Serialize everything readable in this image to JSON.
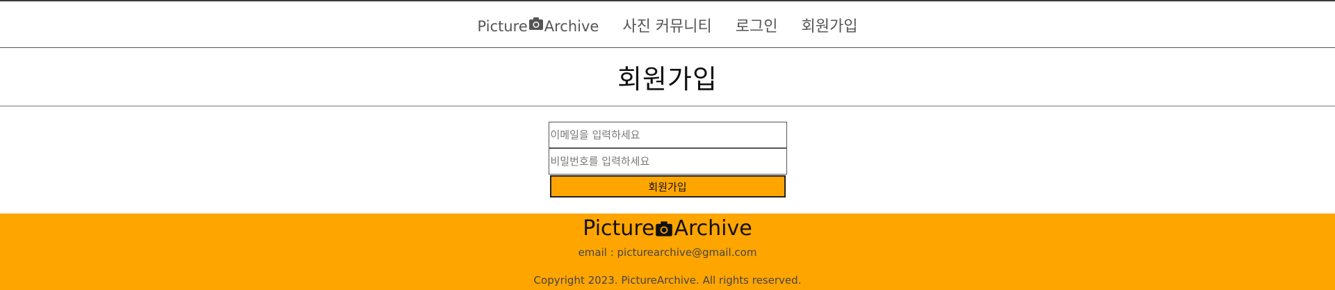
{
  "nav": {
    "logo_left": "Picture",
    "logo_right": "Archive",
    "logo_icon": "camera-icon",
    "items": [
      {
        "label": "사진 커뮤니티"
      },
      {
        "label": "로그인"
      },
      {
        "label": "회원가입"
      }
    ]
  },
  "page": {
    "title": "회원가입"
  },
  "form": {
    "email_placeholder": "이메일을 입력하세요",
    "password_placeholder": "비밀번호를 입력하세요",
    "submit_label": "회원가입"
  },
  "footer": {
    "logo_left": "Picture",
    "logo_right": "Archive",
    "email": "email : picturearchive@gmail.com",
    "copyright": "Copyright 2023. PictureArchive. All rights reserved."
  },
  "colors": {
    "accent": "#ffa500",
    "nav_text": "#555555"
  }
}
